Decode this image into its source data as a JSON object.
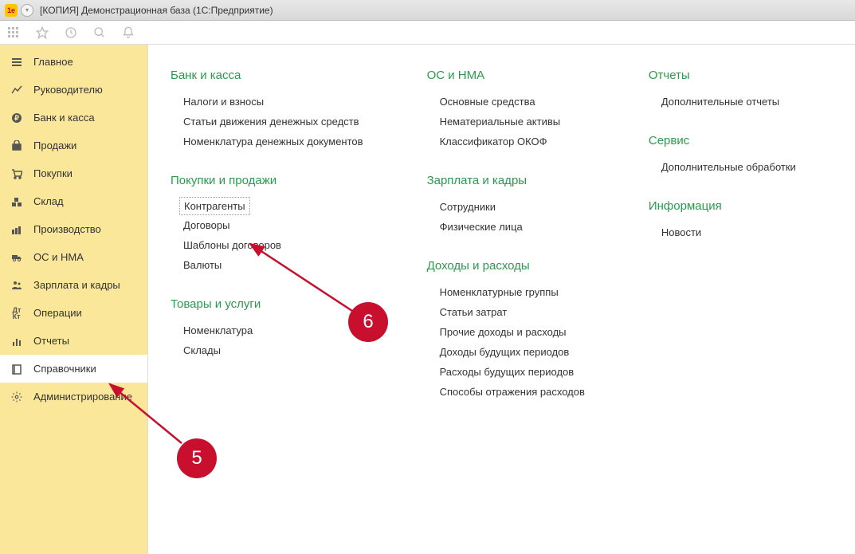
{
  "window": {
    "title": "[КОПИЯ] Демонстрационная база  (1С:Предприятие)"
  },
  "sidebar": {
    "items": [
      {
        "label": "Главное"
      },
      {
        "label": "Руководителю"
      },
      {
        "label": "Банк и касса"
      },
      {
        "label": "Продажи"
      },
      {
        "label": "Покупки"
      },
      {
        "label": "Склад"
      },
      {
        "label": "Производство"
      },
      {
        "label": "ОС и НМА"
      },
      {
        "label": "Зарплата и кадры"
      },
      {
        "label": "Операции"
      },
      {
        "label": "Отчеты"
      },
      {
        "label": "Справочники"
      },
      {
        "label": "Администрирование"
      }
    ]
  },
  "content": {
    "col1": {
      "sections": [
        {
          "title": "Банк и касса",
          "links": [
            "Налоги и взносы",
            "Статьи движения денежных средств",
            "Номенклатура денежных документов"
          ]
        },
        {
          "title": "Покупки и продажи",
          "links": [
            "Контрагенты",
            "Договоры",
            "Шаблоны договоров",
            "Валюты"
          ]
        },
        {
          "title": "Товары и услуги",
          "links": [
            "Номенклатура",
            "Склады"
          ]
        }
      ]
    },
    "col2": {
      "sections": [
        {
          "title": "ОС и НМА",
          "links": [
            "Основные средства",
            "Нематериальные активы",
            "Классификатор ОКОФ"
          ]
        },
        {
          "title": "Зарплата и кадры",
          "links": [
            "Сотрудники",
            "Физические лица"
          ]
        },
        {
          "title": "Доходы и расходы",
          "links": [
            "Номенклатурные группы",
            "Статьи затрат",
            "Прочие доходы и расходы",
            "Доходы будущих периодов",
            "Расходы будущих периодов",
            "Способы отражения расходов"
          ]
        }
      ]
    },
    "col3": {
      "sections": [
        {
          "title": "Отчеты",
          "links": [
            "Дополнительные отчеты"
          ]
        },
        {
          "title": "Сервис",
          "links": [
            "Дополнительные обработки"
          ]
        },
        {
          "title": "Информация",
          "links": [
            "Новости"
          ]
        }
      ]
    }
  },
  "badges": {
    "b5": "5",
    "b6": "6"
  }
}
